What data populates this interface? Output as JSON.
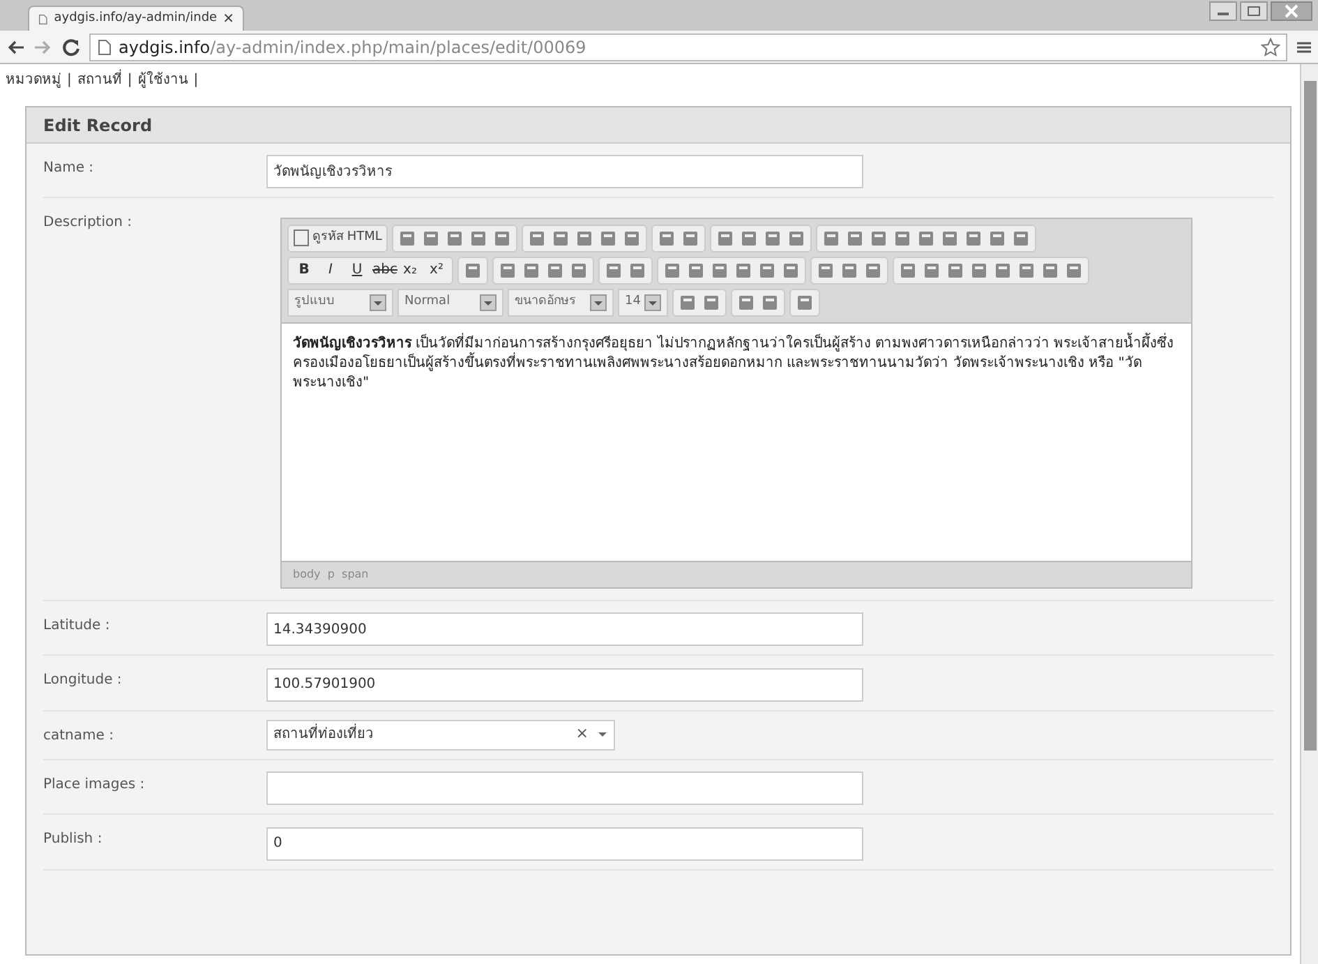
{
  "browser": {
    "tab_title": "aydgis.info/ay-admin/inde",
    "tab_close": "×",
    "url_host": "aydgis.info",
    "url_path": "/ay-admin/index.php/main/places/edit/00069"
  },
  "nav": [
    {
      "label": "หมวดหมู่",
      "separator": "|"
    },
    {
      "label": "สถานที่",
      "separator": "|"
    },
    {
      "label": "ผู้ใช้งาน",
      "separator": "|"
    }
  ],
  "panel": {
    "title": "Edit Record"
  },
  "fields": [
    {
      "kind": "text",
      "label": "Name :",
      "value": "วัดพนัญเชิงวรวิหาร"
    },
    {
      "kind": "editor",
      "label": "Description :"
    },
    {
      "kind": "text",
      "label": "Latitude :",
      "value": "14.34390900"
    },
    {
      "kind": "text",
      "label": "Longitude :",
      "value": "100.57901900"
    },
    {
      "kind": "select",
      "label": "catname :",
      "value": "สถานที่ท่องเที่ยว",
      "clear": "×"
    },
    {
      "kind": "text",
      "label": "Place images :"
    },
    {
      "kind": "text",
      "label": "Publish :",
      "value": "0"
    }
  ],
  "editor": {
    "source_button": "ดูรหัส HTML",
    "format_buttons": [
      "B",
      "I",
      "U",
      "abc",
      "x₂",
      "x²"
    ],
    "combos": [
      {
        "label": "รูปแบบ"
      },
      {
        "label": "Normal"
      },
      {
        "label": "ขนาดอักษร"
      },
      {
        "label": "14"
      }
    ],
    "content": "**วัดพนัญเชิงวรวิหาร** เป็นวัดที่มีมาก่อนการสร้างกรุงศรีอยุธยา ไม่ปรากฏหลักฐานว่าใครเป็นผู้สร้าง ตามพงศาวดารเหนือกล่าวว่า พระเจ้าสายน้ำผึ้งซึ่งครองเมืองอโยธยาเป็นผู้สร้างขึ้นตรงที่พระราชทานเพลิงศพพระนางสร้อยดอกหมาก และพระราชทานนามวัดว่า วัดพระเจ้าพระนางเชิง หรือ \"วัดพระนางเชิง\"",
    "path": "body  p  span"
  }
}
